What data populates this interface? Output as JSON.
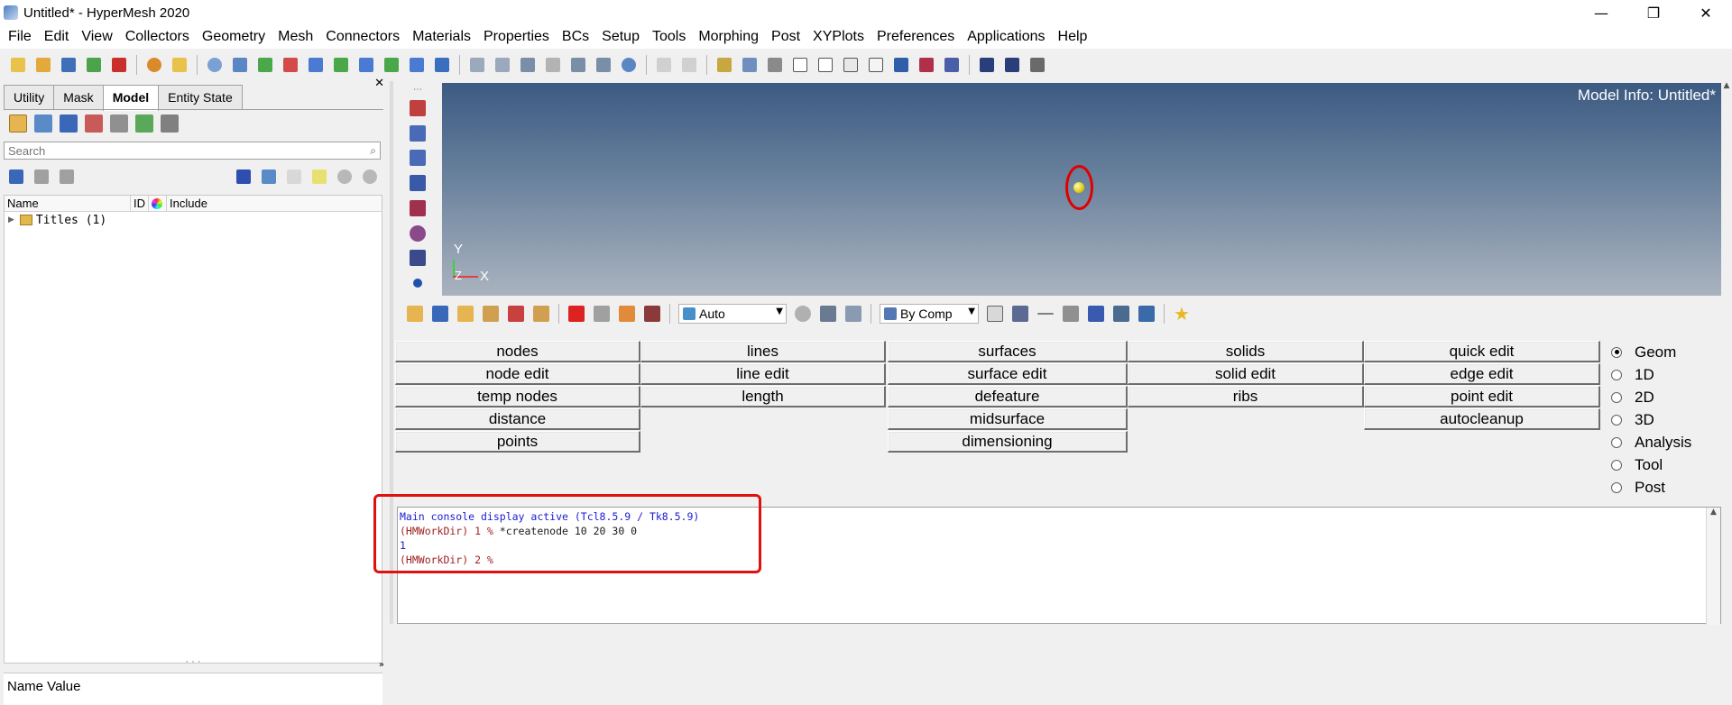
{
  "window": {
    "title": "Untitled* - HyperMesh 2020",
    "controls": [
      "—",
      "❐",
      "✕"
    ]
  },
  "menubar": [
    "File",
    "Edit",
    "View",
    "Collectors",
    "Geometry",
    "Mesh",
    "Connectors",
    "Materials",
    "Properties",
    "BCs",
    "Setup",
    "Tools",
    "Morphing",
    "Post",
    "XYPlots",
    "Preferences",
    "Applications",
    "Help"
  ],
  "toolbar": {
    "icons": [
      "new-model-icon",
      "open-model-icon",
      "save-model-icon",
      "import-icon",
      "export-icon",
      "user-profile-icon",
      "open-folder-icon",
      "zoom-icon",
      "previous-view-icon",
      "view-xy-icon",
      "view-xy-flip-icon",
      "view-zx-icon",
      "view-zx-flip-icon",
      "view-yz-icon",
      "view-iso-icon",
      "view-iso2-icon",
      "snapshot-icon",
      "zoom-box-icon",
      "zoom-out-icon",
      "pan-icon",
      "rotate-icon",
      "move-horizontal-icon",
      "move-vertical-icon",
      "spin-icon",
      "undo-icon",
      "redo-icon",
      "line-tool-icon",
      "ruler-icon",
      "measure-icon",
      "cube-solid-icon",
      "cube-wire-icon",
      "cube-shaded-icon",
      "cube-transparent-icon",
      "mesh-display-icon",
      "mesh-color-icon",
      "mesh-edit-icon",
      "sum-icon",
      "sum-plus-icon",
      "calculator-icon"
    ]
  },
  "left_panel": {
    "tabs": [
      "Utility",
      "Mask",
      "Model",
      "Entity State"
    ],
    "active_tab": "Model",
    "search_placeholder": "Search",
    "tree_header": {
      "name": "Name",
      "id": "ID",
      "include": "Include"
    },
    "tree_rows": [
      {
        "label": "Titles (1)"
      }
    ],
    "properties_header": "Name Value",
    "close_glyph": "✕",
    "splitter_glyph": "· · ·",
    "expand_glyph": "»"
  },
  "viewport": {
    "model_info": "Model Info: Untitled*",
    "axes": {
      "y": "Y",
      "x": "X",
      "z": "Z"
    },
    "background_top": "#3c5a82",
    "background_bottom": "#aab3bf",
    "node_color": "#d6c400",
    "highlight_color": "#e00000"
  },
  "view_toolbar": {
    "color_mode": "Auto",
    "display_by": "By Comp"
  },
  "panel_buttons": {
    "col1": [
      "nodes",
      "node edit",
      "temp nodes",
      "distance",
      "points"
    ],
    "col2": [
      "lines",
      "line edit",
      "length"
    ],
    "col3": [
      "surfaces",
      "surface edit",
      "defeature",
      "midsurface",
      "dimensioning"
    ],
    "col4": [
      "solids",
      "solid edit",
      "ribs"
    ],
    "col5": [
      "quick edit",
      "edge edit",
      "point edit",
      "autocleanup"
    ]
  },
  "page_radios": {
    "options": [
      "Geom",
      "1D",
      "2D",
      "3D",
      "Analysis",
      "Tool",
      "Post"
    ],
    "selected": "Geom"
  },
  "console": {
    "lines": [
      {
        "text": "Main console display active (Tcl8.5.9 / Tk8.5.9)",
        "style": "blue"
      },
      {
        "prompt": "(HMWorkDir) 1 % ",
        "command": "*createnode 10 20 30 0"
      },
      {
        "text": "1",
        "style": "blue"
      },
      {
        "prompt": "(HMWorkDir) 2 % ",
        "command": ""
      }
    ]
  }
}
